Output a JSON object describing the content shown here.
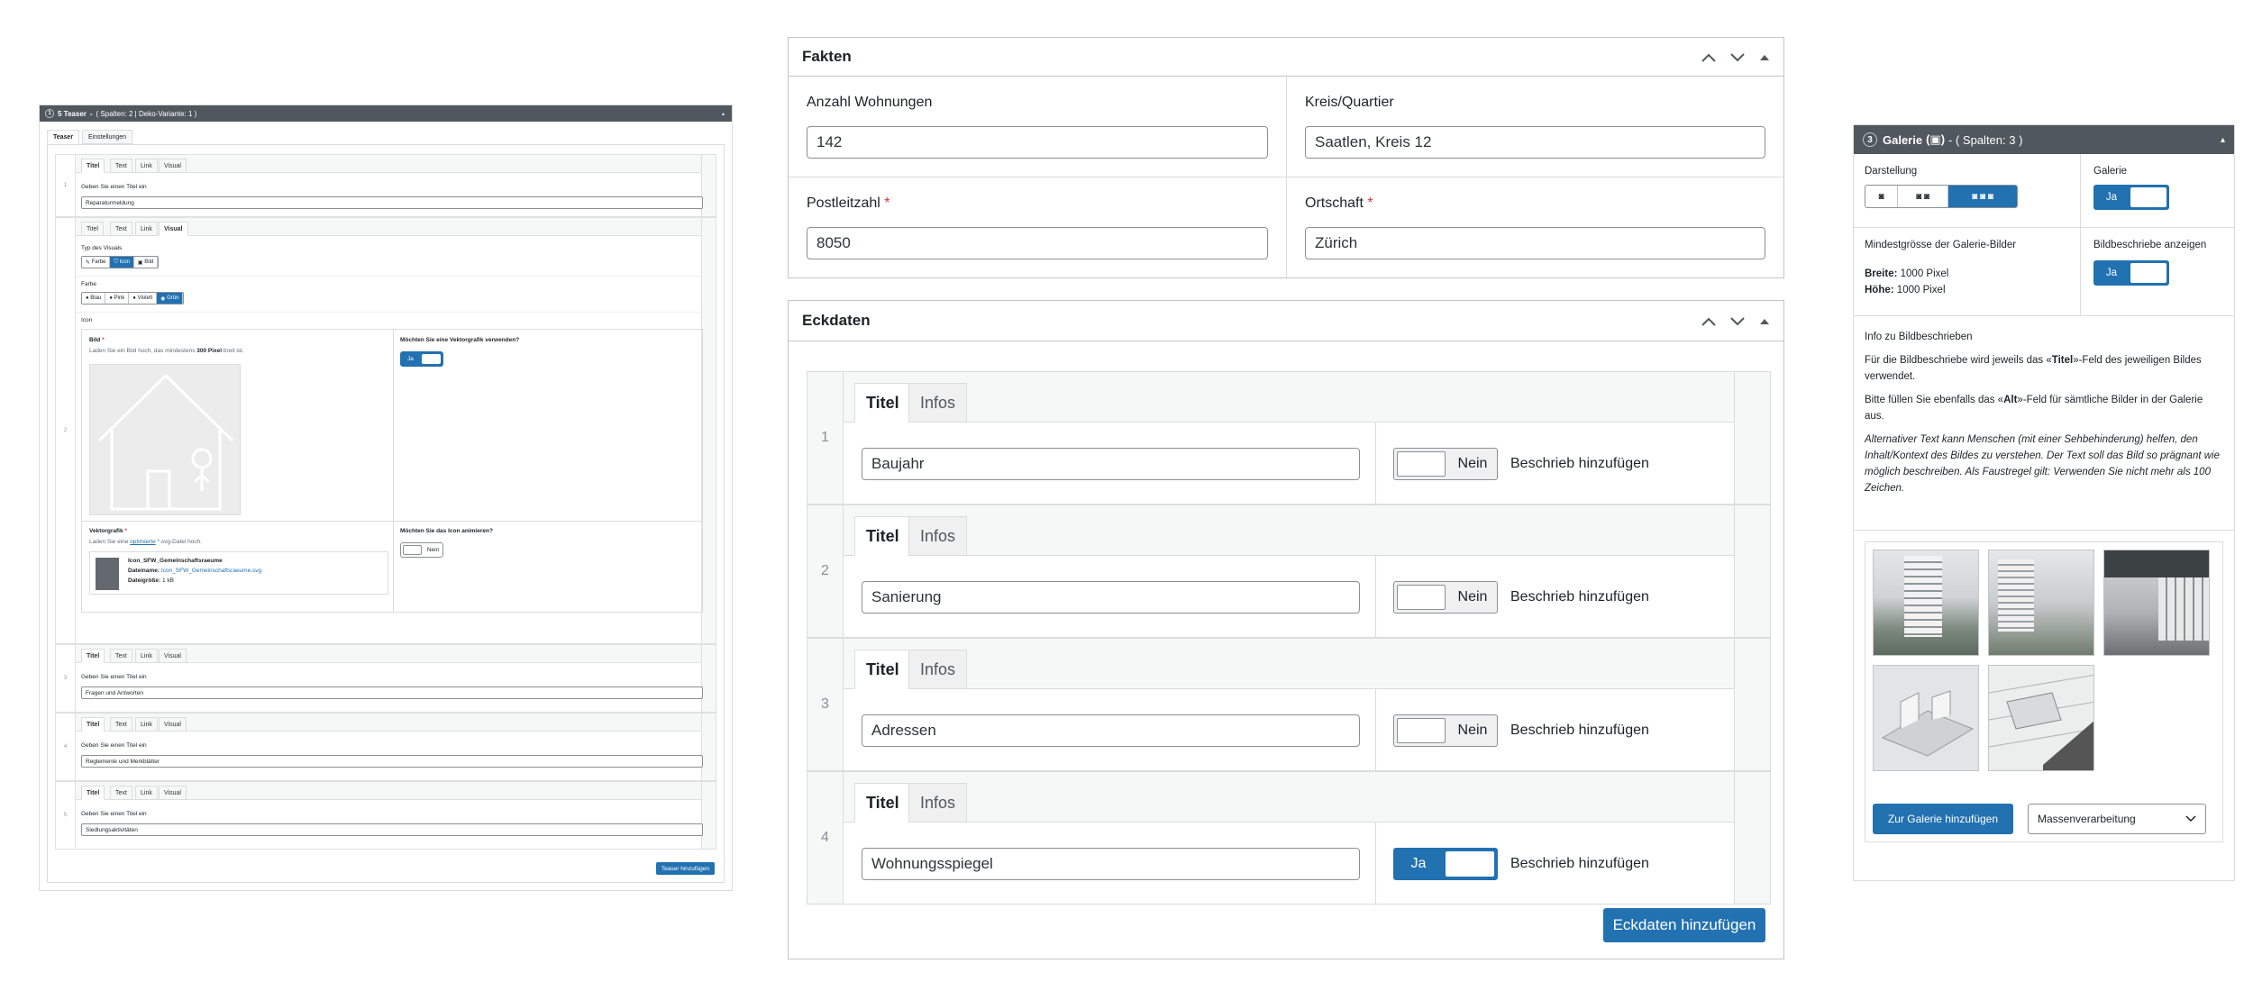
{
  "teaser": {
    "header_number": "1",
    "header_title": "5 Teaser",
    "header_meta": "( Spalten: 2 | Deko-Variante: 1 )",
    "tabs": [
      "Teaser",
      "Einstellungen"
    ],
    "row_tabs": [
      "Titel",
      "Text",
      "Link",
      "Visual"
    ],
    "title_prompt": "Geben Sie einen Titel ein",
    "rows": [
      {
        "num": "1",
        "title": "Reparaturmeldung"
      },
      {
        "num": "2",
        "title": ""
      },
      {
        "num": "3",
        "title": "Fragen und Antworten"
      },
      {
        "num": "4",
        "title": "Reglemente und Merkblätter"
      },
      {
        "num": "5",
        "title": "Siedlungsaktivitäten"
      }
    ],
    "visual": {
      "type_label": "Typ des Visuals",
      "type_options": [
        "Farbe",
        "Icon",
        "Bild"
      ],
      "type_selected": "Icon",
      "color_label": "Farbe",
      "color_options": [
        "Blau",
        "Pink",
        "Violett",
        "Grün"
      ],
      "color_selected": "Grün",
      "icon_label": "Icon",
      "bild_label": "Bild",
      "bild_help_pre": "Laden Sie ein Bild hoch, das mindestens",
      "bild_help_bold": "300 Pixel",
      "bild_help_post": "breit ist.",
      "vector_q": "Möchten Sie eine Vektorgrafik verwenden?",
      "vector_toggle": "Ja",
      "vecgraf_label": "Vektorgrafik",
      "vecgraf_help_pre": "Laden Sie eine",
      "vecgraf_help_link": "optimierte",
      "vecgraf_help_post": "*.svg-Datei hoch.",
      "file_name": "Icon_SFW_Gemeinschaftsraeume",
      "file_label": "Dateiname:",
      "file_value": "Icon_SFW_Gemeinschaftsraeume.svg",
      "size_label": "Dateigröße:",
      "size_value": "1 kB",
      "animate_q": "Möchten Sie das Icon animieren?",
      "animate_toggle": "Nein"
    },
    "add_button": "Teaser hinzufügen"
  },
  "fakten": {
    "title": "Fakten",
    "fields": [
      {
        "label": "Anzahl Wohnungen",
        "value": "142",
        "required": ""
      },
      {
        "label": "Kreis/Quartier",
        "value": "Saatlen, Kreis 12",
        "required": ""
      },
      {
        "label": "Postleitzahl",
        "value": "8050",
        "required": "*"
      },
      {
        "label": "Ortschaft",
        "value": "Zürich",
        "required": "*"
      }
    ]
  },
  "eckdaten": {
    "title": "Eckdaten",
    "tabs": [
      "Titel",
      "Infos"
    ],
    "toggle_add_label": "Beschrieb hinzufügen",
    "rows": [
      {
        "num": "1",
        "value": "Baujahr",
        "toggle": "Nein"
      },
      {
        "num": "2",
        "value": "Sanierung",
        "toggle": "Nein"
      },
      {
        "num": "3",
        "value": "Adressen",
        "toggle": "Nein"
      },
      {
        "num": "4",
        "value": "Wohnungsspiegel",
        "toggle": "Ja"
      }
    ],
    "add_button": "Eckdaten hinzufügen"
  },
  "galerie": {
    "header_number": "3",
    "header_title": "Galerie",
    "header_meta": "- ( Spalten: 3 )",
    "darstellung_label": "Darstellung",
    "galerie_label": "Galerie",
    "galerie_toggle": "Ja",
    "min_label": "Mindestgrösse der Galerie-Bilder",
    "breite_label": "Breite:",
    "breite_value": "1000 Pixel",
    "hoehe_label": "Höhe:",
    "hoehe_value": "1000 Pixel",
    "beschrieb_label": "Bildbeschriebe anzeigen",
    "beschrieb_toggle": "Ja",
    "info_title": "Info zu Bildbeschrieben",
    "info_p1_pre": "Für die Bildbeschriebe wird jeweils das «",
    "info_p1_bold": "Titel",
    "info_p1_post": "»-Feld des jeweiligen Bildes verwendet.",
    "info_p2_pre": "Bitte füllen Sie ebenfalls das «",
    "info_p2_bold": "Alt",
    "info_p2_post": "»-Feld für sämtliche Bilder in der Galerie aus.",
    "info_p3": "Alternativer Text kann Menschen (mit einer Sehbehinderung) helfen, den Inhalt/Kontext des Bildes zu verstehen. Der Text soll das Bild so prägnant wie möglich beschreiben. Als Faustregel gilt: Verwenden Sie nicht mehr als 100 Zeichen.",
    "add_button": "Zur Galerie hinzufügen",
    "bulk_select": "Massenverarbeitung"
  }
}
